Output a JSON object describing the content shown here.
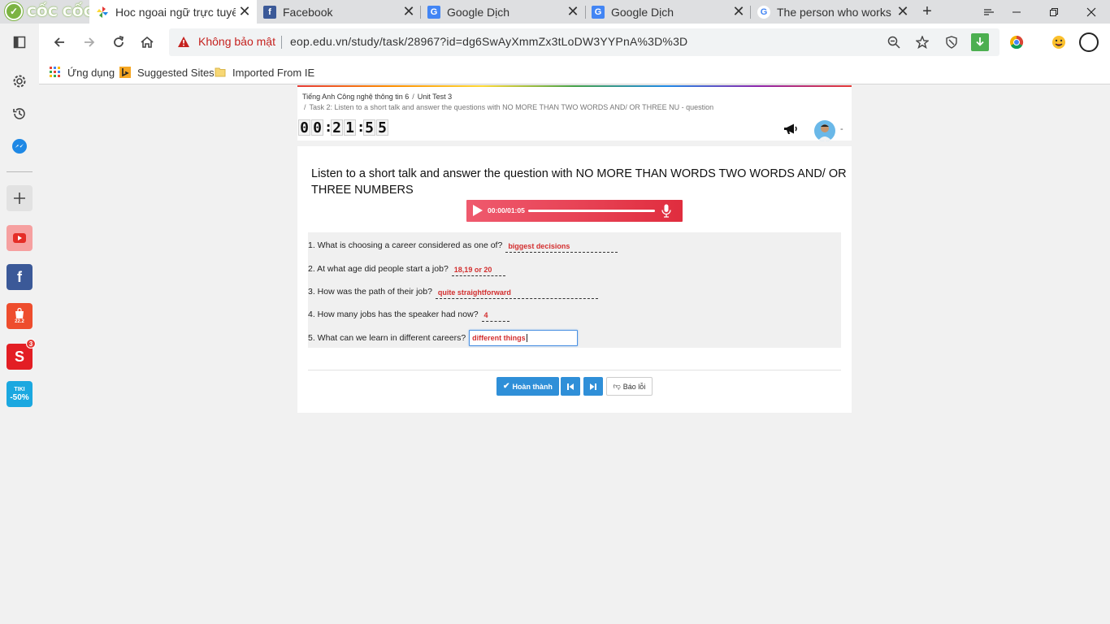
{
  "browser": {
    "brand": "CỐC CỐC",
    "tabs": [
      {
        "title": "Hoc ngoai ngữ trực tuyến",
        "icon": "pinwheel-icon",
        "active": true
      },
      {
        "title": "Facebook",
        "icon": "facebook-icon",
        "active": false
      },
      {
        "title": "Google Dịch",
        "icon": "google-translate-icon",
        "active": false
      },
      {
        "title": "Google Dịch",
        "icon": "google-translate-icon",
        "active": false
      },
      {
        "title": "The person who works w",
        "icon": "google-icon",
        "active": false
      }
    ],
    "security_text": "Không bảo mật",
    "url": "eop.edu.vn/study/task/28967?id=dg6SwAyXmmZx3tLoDW3YYPnA%3D%3D",
    "bookmarks": [
      {
        "label": "Ứng dụng",
        "icon": "apps-grid-icon"
      },
      {
        "label": "Suggested Sites",
        "icon": "bing-icon"
      },
      {
        "label": "Imported From IE",
        "icon": "folder-icon"
      }
    ],
    "sidebar": {
      "shopee_label": "22.2",
      "sendo_badge": "3",
      "tiki_label_top": "TIKI",
      "tiki_label_bottom": "-50%"
    }
  },
  "page": {
    "breadcrumb": [
      "Tiếng Anh Công nghệ thông tin 6",
      "Unit Test 3"
    ],
    "task_line": "Task 2: Listen to a short talk and answer the questions with NO MORE THAN TWO WORDS AND/ OR THREE NU - question",
    "timer": {
      "hours": "00",
      "minutes": "21",
      "seconds": "55"
    },
    "user_suffix": "-",
    "instruction": "Listen to a short talk and answer the question with NO MORE THAN WORDS TWO WORDS AND/ OR THREE NUMBERS",
    "audio": {
      "time": "00:00/01:05",
      "progress": 0
    },
    "questions": [
      {
        "text": "1. What is choosing a career considered as one of?",
        "answer": "biggest decisions"
      },
      {
        "text": "2. At what age did people start a job?",
        "answer": "18,19 or 20"
      },
      {
        "text": "3. How was the path of their job?",
        "answer": "quite straightforward"
      },
      {
        "text": "4. How many jobs has the speaker had now?",
        "answer": "4"
      },
      {
        "text": "5. What can we learn in different careers?",
        "answer": "different things"
      }
    ],
    "buttons": {
      "finish": "Hoàn thành",
      "report": "Báo lỗi"
    }
  },
  "colors": {
    "accent": "#2f8fd8",
    "answer_text": "#d32f2f",
    "audio_start": "#ef5a6e",
    "audio_end": "#e02d3e",
    "insecure": "#c5221f"
  }
}
